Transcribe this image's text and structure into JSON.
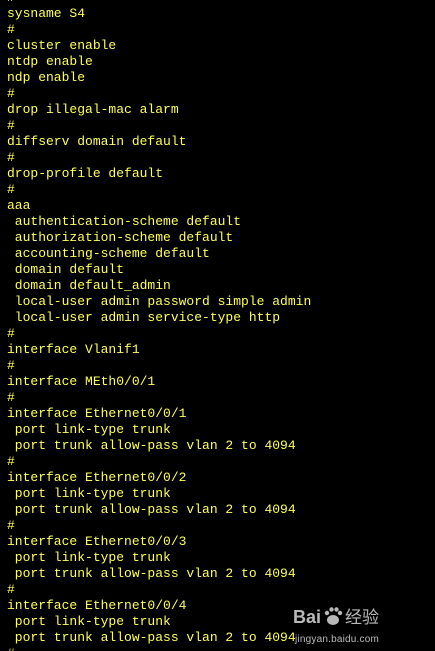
{
  "terminal": {
    "text_color": "#ffff55",
    "background": "#000000",
    "lines": [
      "#",
      "sysname S4",
      "#",
      "cluster enable",
      "ntdp enable",
      "ndp enable",
      "#",
      "drop illegal-mac alarm",
      "#",
      "diffserv domain default",
      "#",
      "drop-profile default",
      "#",
      "aaa",
      " authentication-scheme default",
      " authorization-scheme default",
      " accounting-scheme default",
      " domain default",
      " domain default_admin",
      " local-user admin password simple admin",
      " local-user admin service-type http",
      "#",
      "interface Vlanif1",
      "#",
      "interface MEth0/0/1",
      "#",
      "interface Ethernet0/0/1",
      " port link-type trunk",
      " port trunk allow-pass vlan 2 to 4094",
      "#",
      "interface Ethernet0/0/2",
      " port link-type trunk",
      " port trunk allow-pass vlan 2 to 4094",
      "#",
      "interface Ethernet0/0/3",
      " port link-type trunk",
      " port trunk allow-pass vlan 2 to 4094",
      "#",
      "interface Ethernet0/0/4",
      " port link-type trunk",
      " port trunk allow-pass vlan 2 to 4094",
      "#"
    ]
  },
  "watermark": {
    "logo_text": "Bai经验",
    "url": "jingyan.baidu.com",
    "icon": "baidu-paw-icon"
  }
}
